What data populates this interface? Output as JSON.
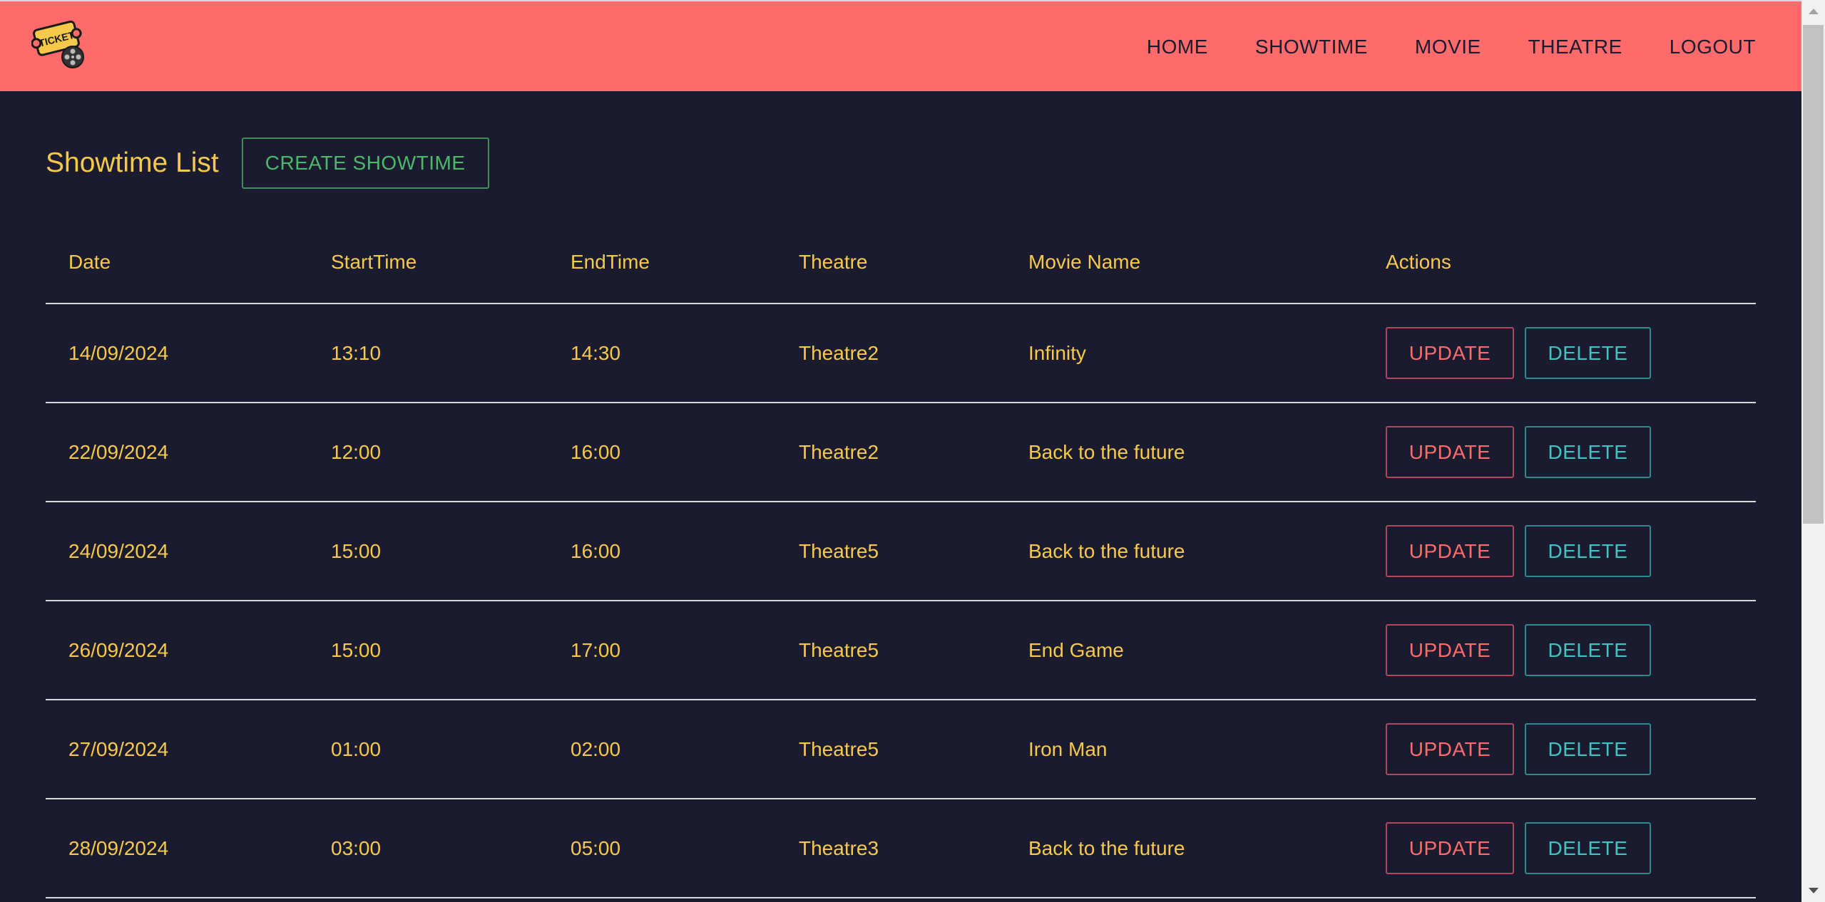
{
  "nav": {
    "logo_text": "TICKET",
    "items": [
      "HOME",
      "SHOWTIME",
      "MOVIE",
      "THEATRE",
      "LOGOUT"
    ]
  },
  "page": {
    "title": "Showtime List",
    "create_label": "CREATE SHOWTIME"
  },
  "table": {
    "headers": [
      "Date",
      "StartTime",
      "EndTime",
      "Theatre",
      "Movie Name",
      "Actions"
    ],
    "rows": [
      [
        "14/09/2024",
        "13:10",
        "14:30",
        "Theatre2",
        "Infinity"
      ],
      [
        "22/09/2024",
        "12:00",
        "16:00",
        "Theatre2",
        "Back to the future"
      ],
      [
        "24/09/2024",
        "15:00",
        "16:00",
        "Theatre5",
        "Back to the future"
      ],
      [
        "26/09/2024",
        "15:00",
        "17:00",
        "Theatre5",
        "End Game"
      ],
      [
        "27/09/2024",
        "01:00",
        "02:00",
        "Theatre5",
        "Iron Man"
      ],
      [
        "28/09/2024",
        "03:00",
        "05:00",
        "Theatre3",
        "Back to the future"
      ]
    ],
    "update_label": "UPDATE",
    "delete_label": "DELETE"
  },
  "colors": {
    "navbar": "#ff6b6b",
    "background": "#1a1b2e",
    "text": "#f7c94a",
    "create": "#4cb86a",
    "update": "#ff6b6b",
    "delete": "#3fc4c4"
  }
}
